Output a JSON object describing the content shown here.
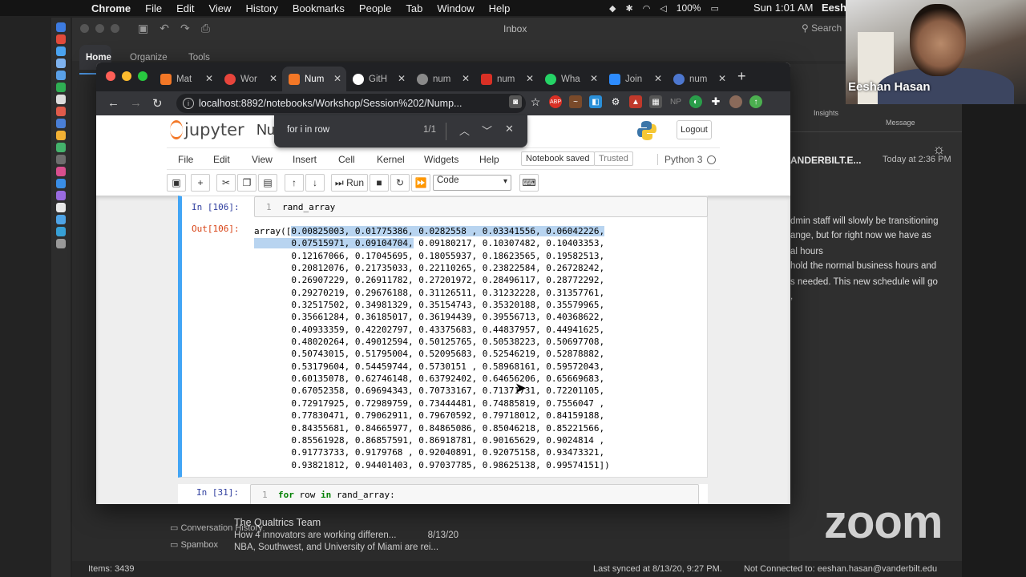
{
  "mac_menu": {
    "app": "Chrome",
    "items": [
      "File",
      "Edit",
      "View",
      "History",
      "Bookmarks",
      "People",
      "Tab",
      "Window",
      "Help"
    ],
    "battery": "100%",
    "clock": "Sun 1:01 AM",
    "user": "Eesh"
  },
  "outlook": {
    "title": "Inbox",
    "search": "Search",
    "ribbon_tabs": [
      "Home",
      "Organize",
      "Tools"
    ],
    "insights": "Insights",
    "message": "Message",
    "sender": "ANDERBILT.E...",
    "date": "Today at 2:36 PM",
    "body": [
      "dmin staff will slowly be transitioning",
      "ange, but for right now we have as",
      "",
      "al hours",
      "hold the normal business hours and",
      "",
      "s needed. This new schedule will go",
      ","
    ],
    "folders": [
      "Conversation History",
      "Spambox"
    ],
    "list_from": "The Qualtrics Team",
    "list_subject": "How 4 innovators are working differen...",
    "list_date": "8/13/20",
    "list_preview": "NBA, Southwest, and University of Miami are rei...",
    "status_items": "Items: 3439",
    "status_sync": "Last synced at 8/13/20, 9:27 PM.",
    "status_conn": "Not Connected to: eeshan.hasan@vanderbilt.edu"
  },
  "chrome": {
    "tabs": [
      {
        "title": "Mat",
        "color": "#f37726"
      },
      {
        "title": "Wor",
        "color": "#e8453c"
      },
      {
        "title": "Num",
        "color": "#f37726",
        "active": true
      },
      {
        "title": "GitH",
        "color": "#ffffff"
      },
      {
        "title": "num",
        "color": "#8a8a8a"
      },
      {
        "title": "num",
        "color": "#d93025"
      },
      {
        "title": "Wha",
        "color": "#25d366"
      },
      {
        "title": "Join",
        "color": "#2d8cff"
      },
      {
        "title": "num",
        "color": "#4d77cf"
      }
    ],
    "url": "localhost:8892/notebooks/Workshop/Session%202/Nump...",
    "find_query": "for i in row",
    "find_count": "1/1"
  },
  "jupyter": {
    "logo": "jupyter",
    "notebook_name": "Nu",
    "logout": "Logout",
    "menus": [
      "File",
      "Edit",
      "View",
      "Insert",
      "Cell",
      "Kernel",
      "Widgets",
      "Help"
    ],
    "saved": "Notebook saved",
    "trusted": "Trusted",
    "kernel": "Python 3",
    "run_label": "Run",
    "cell_type": "Code",
    "cell1": {
      "in_prompt": "In [106]:",
      "line": "1",
      "code": "rand_array",
      "out_prompt": "Out[106]:",
      "output_first_hl": "0.00825003, 0.01775386, 0.0282558 , 0.03341556, 0.06042226,",
      "output_second_hl": "0.07515971, 0.09104704,",
      "output_second_rest": " 0.09180217, 0.10307482, 0.10403353,",
      "output_rest": [
        "0.12167066, 0.17045695, 0.18055937, 0.18623565, 0.19582513,",
        "0.20812076, 0.21735033, 0.22110265, 0.23822584, 0.26728242,",
        "0.26907229, 0.26911782, 0.27201972, 0.28496117, 0.28772292,",
        "0.29270219, 0.29676188, 0.31126511, 0.31232228, 0.31357761,",
        "0.32517502, 0.34981329, 0.35154743, 0.35320188, 0.35579965,",
        "0.35661284, 0.36185017, 0.36194439, 0.39556713, 0.40368622,",
        "0.40933359, 0.42202797, 0.43375683, 0.44837957, 0.44941625,",
        "0.48020264, 0.49012594, 0.50125765, 0.50538223, 0.50697708,",
        "0.50743015, 0.51795004, 0.52095683, 0.52546219, 0.52878882,",
        "0.53179604, 0.54459744, 0.5730151 , 0.58968161, 0.59572043,",
        "0.60135078, 0.62746148, 0.63792402, 0.64656206, 0.65669683,",
        "0.67052358, 0.69694343, 0.70733167, 0.71371731, 0.72201105,",
        "0.72917925, 0.72989759, 0.73444481, 0.74885819, 0.7556047 ,",
        "0.77830471, 0.79062911, 0.79670592, 0.79718012, 0.84159188,",
        "0.84355681, 0.84665977, 0.84865086, 0.85046218, 0.85221566,",
        "0.85561928, 0.86857591, 0.86918781, 0.90165629, 0.9024814 ,",
        "0.91773733, 0.9179768 , 0.92040891, 0.92075158, 0.93473321,",
        "0.93821812, 0.94401403, 0.97037785, 0.98625138, 0.99574151])"
      ]
    },
    "cell2": {
      "in_prompt": "In [31]:",
      "line": "1",
      "kw1": "for",
      "mid": " row ",
      "kw2": "in",
      "rest": " rand_array:"
    }
  },
  "zoom": {
    "participant": "Eeshan Hasan",
    "logo": "zoom"
  }
}
